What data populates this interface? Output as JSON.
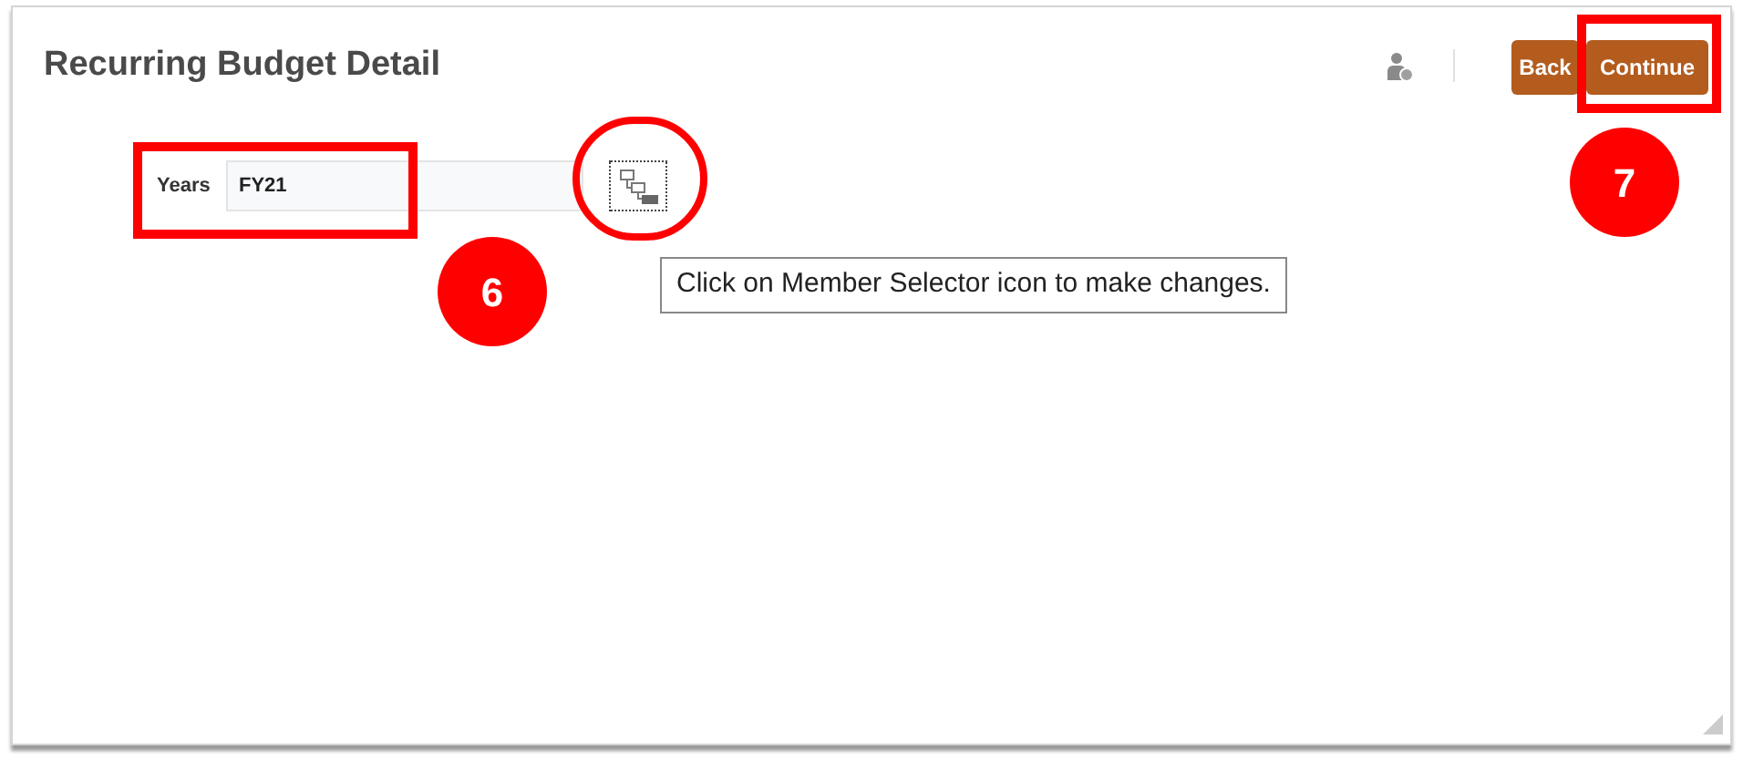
{
  "page": {
    "title": "Recurring Budget Detail"
  },
  "prompt": {
    "label": "Years",
    "value": "FY21"
  },
  "tooltip": "Click on Member Selector icon to make changes.",
  "buttons": [
    {
      "label": "Back",
      "kind": "secondary"
    },
    {
      "label": "Continue",
      "kind": "primary"
    }
  ],
  "callouts": [
    {
      "number": "6"
    },
    {
      "number": "7"
    }
  ]
}
